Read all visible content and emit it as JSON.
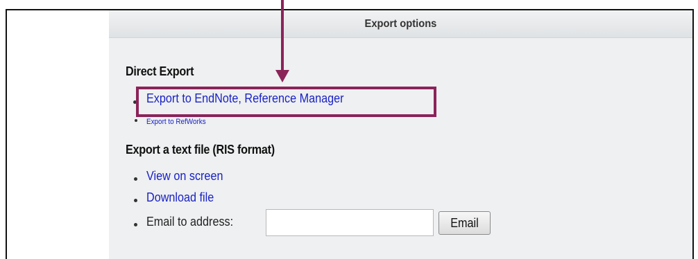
{
  "panel": {
    "title": "Export options"
  },
  "direct_export": {
    "heading": "Direct Export",
    "links": [
      {
        "label": "Export to EndNote, Reference Manager",
        "icon": "bullet"
      },
      {
        "label": "Export to RefWorks",
        "icon": "bullet"
      }
    ]
  },
  "text_export": {
    "heading": "Export a text file (RIS format)",
    "links": [
      {
        "label": "View on screen",
        "icon": "bullet"
      },
      {
        "label": "Download file",
        "icon": "bullet"
      }
    ],
    "email": {
      "label": "Email to address:",
      "value": "",
      "placeholder": "",
      "button_label": "Email"
    }
  },
  "annotation": {
    "highlight_color": "#8b2359",
    "target": "Export to EndNote, Reference Manager"
  },
  "colors": {
    "link": "#1a22c4",
    "panel_bg": "#eef0f1",
    "header_bg": "#dfe2e4"
  }
}
